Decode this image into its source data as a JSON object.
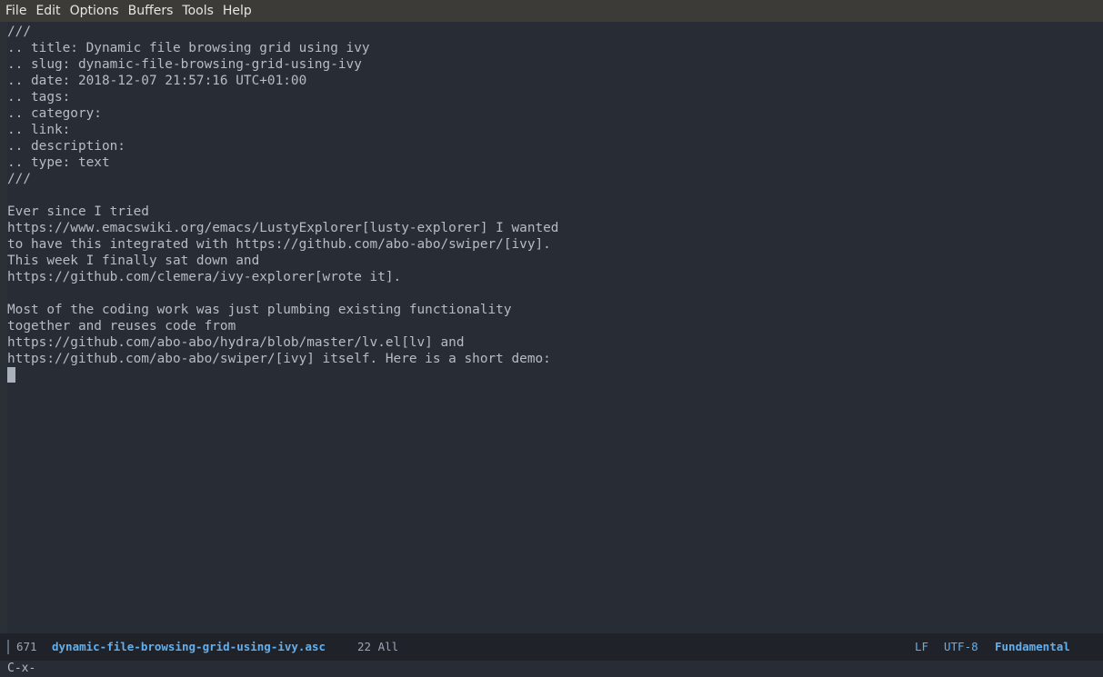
{
  "menubar": {
    "items": [
      "File",
      "Edit",
      "Options",
      "Buffers",
      "Tools",
      "Help"
    ]
  },
  "buffer": {
    "lines": [
      "///",
      ".. title: Dynamic file browsing grid using ivy",
      ".. slug: dynamic-file-browsing-grid-using-ivy",
      ".. date: 2018-12-07 21:57:16 UTC+01:00",
      ".. tags:",
      ".. category:",
      ".. link:",
      ".. description:",
      ".. type: text",
      "///",
      "",
      "Ever since I tried",
      "https://www.emacswiki.org/emacs/LustyExplorer[lusty-explorer] I wanted",
      "to have this integrated with https://github.com/abo-abo/swiper/[ivy].",
      "This week I finally sat down and",
      "https://github.com/clemera/ivy-explorer[wrote it].",
      "",
      "Most of the coding work was just plumbing existing functionality",
      "together and reuses code from",
      "https://github.com/abo-abo/hydra/blob/master/lv.el[lv] and",
      "https://github.com/abo-abo/swiper/[ivy] itself. Here is a short demo:",
      ""
    ]
  },
  "modeline": {
    "size": "671",
    "buffer_name": "dynamic-file-browsing-grid-using-ivy.asc",
    "position": "22 All",
    "eol": "LF",
    "encoding": "UTF-8",
    "major_mode": "Fundamental"
  },
  "minibuffer": {
    "text": "C-x-"
  },
  "colors": {
    "background": "#282c34",
    "text": "#b6bcc6",
    "accent": "#61afef",
    "menubar": "#3d3b37"
  }
}
